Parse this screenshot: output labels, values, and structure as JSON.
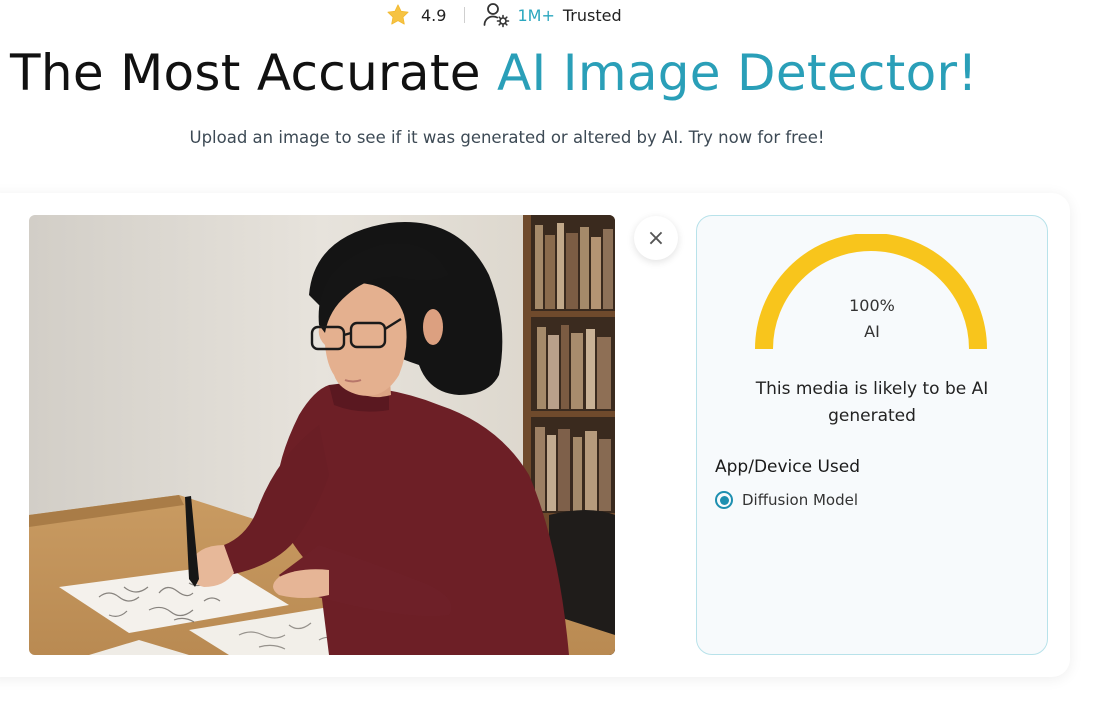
{
  "stats": {
    "rating": "4.9",
    "count": "1M+",
    "trusted": "Trusted"
  },
  "hero": {
    "title_plain": "The Most Accurate ",
    "title_accent": "AI Image Detector!",
    "subtitle": "Upload an image to see if it was generated or altered by AI. Try now for free!"
  },
  "close_symbol": "×",
  "result": {
    "gauge_value": "100%",
    "gauge_label": "AI",
    "gauge_fraction": 1.0,
    "gauge_color": "#f8c51c",
    "verdict": "This media is likely to be AI generated",
    "device_section_title": "App/Device Used",
    "device_option": "Diffusion Model"
  },
  "colors": {
    "accent": "#2a9fb8",
    "radio": "#1d8fb0"
  },
  "icons": [
    "star-icon",
    "user-gear-icon",
    "close-icon"
  ]
}
